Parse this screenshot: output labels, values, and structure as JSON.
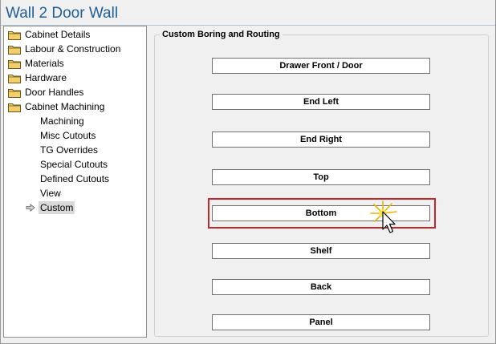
{
  "window": {
    "title": "Wall 2 Door Wall"
  },
  "tree": {
    "items": [
      {
        "label": "Cabinet Details",
        "type": "folder"
      },
      {
        "label": "Labour & Construction",
        "type": "folder"
      },
      {
        "label": "Materials",
        "type": "folder"
      },
      {
        "label": "Hardware",
        "type": "folder"
      },
      {
        "label": "Door Handles",
        "type": "folder"
      },
      {
        "label": "Cabinet Machining",
        "type": "folder"
      },
      {
        "label": "Machining",
        "type": "child"
      },
      {
        "label": "Misc Cutouts",
        "type": "child"
      },
      {
        "label": "TG Overrides",
        "type": "child"
      },
      {
        "label": "Special Cutouts",
        "type": "child"
      },
      {
        "label": "Defined Cutouts",
        "type": "child"
      },
      {
        "label": "View",
        "type": "child"
      },
      {
        "label": "Custom",
        "type": "child-selected"
      }
    ]
  },
  "group": {
    "title": "Custom Boring and Routing",
    "buttons": [
      {
        "label": "Drawer Front / Door"
      },
      {
        "label": "End Left"
      },
      {
        "label": "End Right"
      },
      {
        "label": "Top"
      },
      {
        "label": "Bottom"
      },
      {
        "label": "Shelf"
      },
      {
        "label": "Back"
      },
      {
        "label": "Panel"
      }
    ]
  },
  "colors": {
    "title": "#1f5f99",
    "highlight": "#c0282a",
    "folder": "#f2cf6a"
  },
  "icons": {
    "folder": "folder-icon",
    "arrow": "arrow-right-icon",
    "cursor": "mouse-pointer-icon"
  }
}
